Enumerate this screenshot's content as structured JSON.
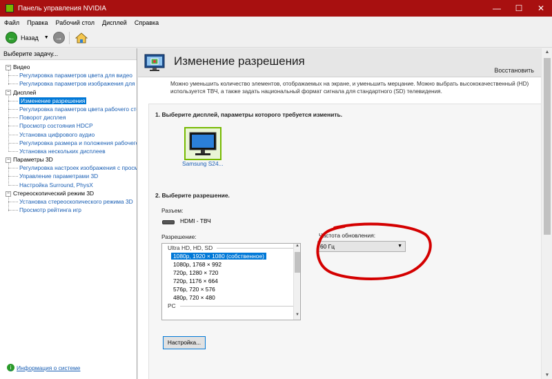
{
  "window": {
    "title": "Панель управления NVIDIA",
    "minimize_icon": "minimize-icon",
    "maximize_icon": "maximize-icon",
    "close_icon": "close-icon"
  },
  "menu": [
    "Файл",
    "Правка",
    "Рабочий стол",
    "Дисплей",
    "Справка"
  ],
  "toolbar": {
    "back_label": "Назад",
    "icons": [
      "back-arrow-icon",
      "dropdown-arrow-icon",
      "forward-arrow-icon",
      "home-icon"
    ]
  },
  "left_panel": {
    "heading": "Выберите задачу...",
    "tree": [
      {
        "label": "Видео",
        "children": [
          "Регулировка параметров цвета для видео",
          "Регулировка параметров изображения для видео"
        ]
      },
      {
        "label": "Дисплей",
        "children": [
          "Изменение разрешения",
          "Регулировка параметров цвета рабочего стола",
          "Поворот дисплея",
          "Просмотр состояния HDCP",
          "Установка цифрового аудио",
          "Регулировка размера и положения рабочего стола",
          "Установка нескольких дисплеев"
        ]
      },
      {
        "label": "Параметры 3D",
        "children": [
          "Регулировка настроек изображения с просмотром",
          "Управление параметрами 3D",
          "Настройка Surround, PhysX"
        ]
      },
      {
        "label": "Стереоскопический режим 3D",
        "children": [
          "Установка стереоскопического режима 3D",
          "Просмотр рейтинга игр"
        ]
      }
    ],
    "selected": "Изменение разрешения",
    "system_info": "Информация о системе"
  },
  "main": {
    "title": "Изменение разрешения",
    "restore_label": "Восстановить",
    "description": "Можно уменьшить количество элементов, отображаемых на экране, и уменьшить мерцание. Можно выбрать высококачественный (HD) используется ТВЧ, а также задать национальный формат сигнала для стандартного (SD) телевидения.",
    "step1_title": "1. Выберите дисплей, параметры которого требуется изменить.",
    "display_name": "Samsung S24...",
    "step2_title": "2. Выберите разрешение.",
    "connector_label": "Разъем:",
    "connector_value": "HDMI - ТВЧ",
    "resolution_label": "Разрешение:",
    "resolution_groups": [
      {
        "name": "Ultra HD, HD, SD",
        "items": [
          "1080p, 1920 × 1080 (собственное)",
          "1080p, 1768 × 992",
          "720p, 1280 × 720",
          "720p, 1176 × 664",
          "576p, 720 × 576",
          "480p, 720 × 480"
        ]
      },
      {
        "name": "PC",
        "items": []
      }
    ],
    "selected_resolution": "1080p, 1920 × 1080 (собственное)",
    "refresh_label": "Частота обновления:",
    "refresh_value": "60 Гц",
    "settings_button": "Настройка...",
    "annotation_color": "#d40000"
  },
  "colors": {
    "titlebar": "#a81010",
    "selection": "#0078d7",
    "nvidia_green": "#76b900",
    "link": "#1a5fb4"
  }
}
